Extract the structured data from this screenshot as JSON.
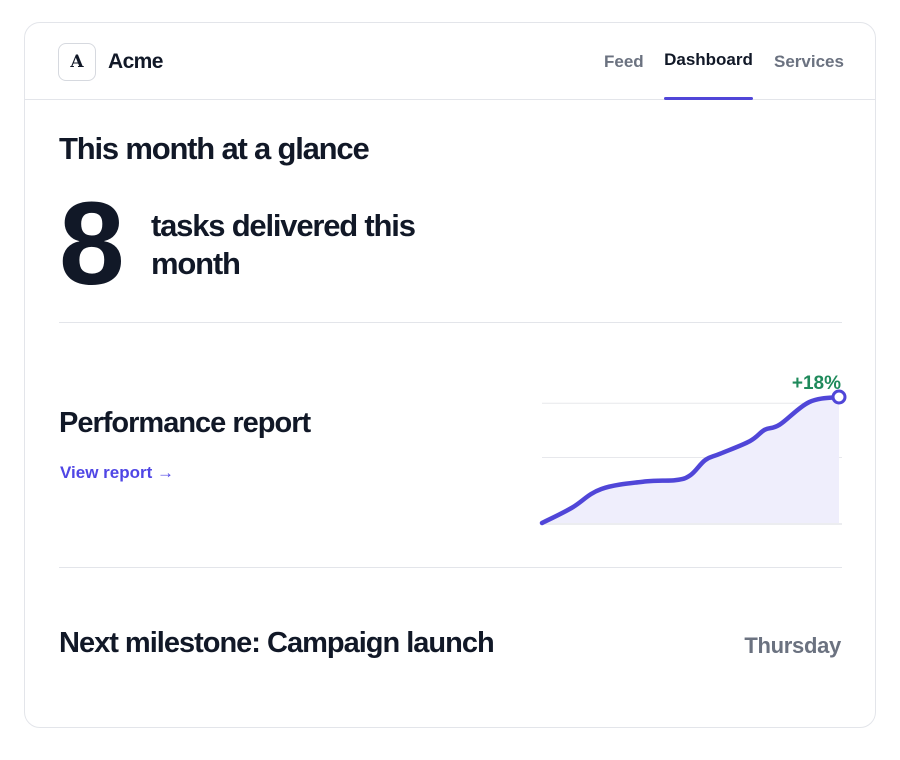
{
  "header": {
    "logo_letter": "A",
    "brand": "Acme",
    "tabs": [
      {
        "label": "Feed",
        "active": false
      },
      {
        "label": "Dashboard",
        "active": true
      },
      {
        "label": "Services",
        "active": false
      }
    ]
  },
  "overview": {
    "title": "This month at a glance",
    "metric_value": "8",
    "metric_label": "tasks delivered this month"
  },
  "performance": {
    "title": "Performance report",
    "link_label": "View report →",
    "change_label": "+18%"
  },
  "milestone": {
    "title": "Next milestone: Campaign launch",
    "day": "Thursday"
  },
  "colors": {
    "accent": "#4f46e5",
    "line": "#5046d8",
    "area": "#efeefc",
    "positive": "#1f8a5b",
    "muted": "#6b7280",
    "text": "#111827"
  },
  "chart_data": {
    "type": "area",
    "x": [
      0,
      0.1,
      0.2,
      0.35,
      0.45,
      0.5,
      0.55,
      0.6,
      0.7,
      0.75,
      0.8,
      0.9,
      1.0
    ],
    "values": [
      0.0,
      0.12,
      0.27,
      0.33,
      0.34,
      0.38,
      0.5,
      0.55,
      0.65,
      0.74,
      0.78,
      0.96,
      1.0
    ],
    "ylim": [
      0,
      1
    ],
    "grid": true,
    "annotation": "+18%"
  }
}
